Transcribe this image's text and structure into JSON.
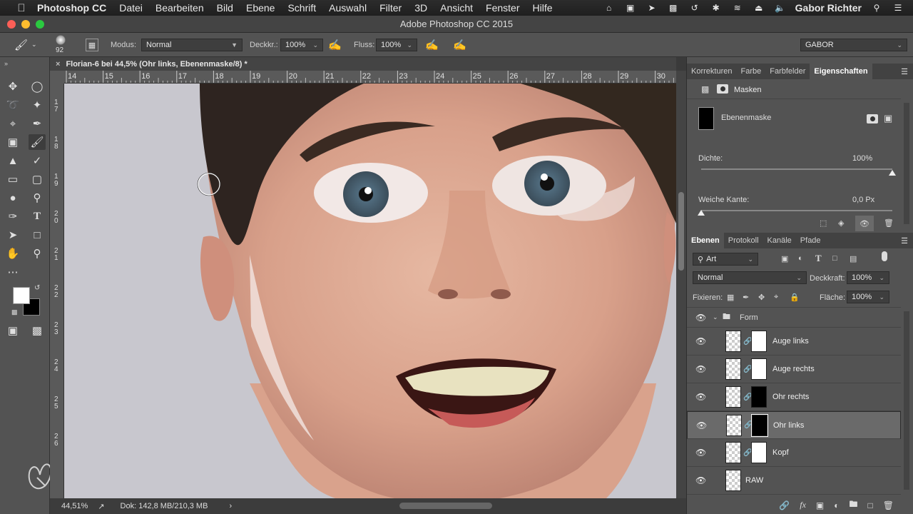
{
  "menubar": {
    "app": "Photoshop CC",
    "items": [
      "Datei",
      "Bearbeiten",
      "Bild",
      "Ebene",
      "Schrift",
      "Auswahl",
      "Filter",
      "3D",
      "Ansicht",
      "Fenster",
      "Hilfe"
    ],
    "user": "Gabor Richter"
  },
  "window": {
    "title": "Adobe Photoshop CC 2015"
  },
  "options": {
    "brush_size": "92",
    "modus_label": "Modus:",
    "modus_value": "Normal",
    "deckkraft_label": "Deckkr.:",
    "deckkraft_value": "100%",
    "fluss_label": "Fluss:",
    "fluss_value": "100%",
    "workspace": "GABOR"
  },
  "document": {
    "tab_title": "Florian-6 bei 44,5% (Ohr links, Ebenenmaske/8) *",
    "ruler_h": [
      "14",
      "15",
      "16",
      "17",
      "18",
      "19",
      "20",
      "21",
      "22",
      "23",
      "24",
      "25",
      "26",
      "27",
      "28",
      "29",
      "30"
    ],
    "ruler_v": [
      "1\n7",
      "1\n8",
      "1\n9",
      "2\n0",
      "2\n1",
      "2\n2",
      "2\n3",
      "2\n4",
      "2\n5",
      "2\n6"
    ]
  },
  "status": {
    "zoom": "44,51%",
    "doc": "Dok: 142,8 MB/210,3 MB"
  },
  "properties_panel": {
    "tabs": [
      "Korrekturen",
      "Farbe",
      "Farbfelder",
      "Eigenschaften"
    ],
    "active_tab": "Eigenschaften",
    "header": "Masken",
    "mask_label": "Ebenenmaske",
    "dichte_label": "Dichte:",
    "dichte_value": "100%",
    "dichte_fraction": 1.0,
    "weiche_label": "Weiche Kante:",
    "weiche_value": "0,0 Px",
    "weiche_fraction": 0.0
  },
  "layers_panel": {
    "tabs": [
      "Ebenen",
      "Protokoll",
      "Kanäle",
      "Pfade"
    ],
    "active_tab": "Ebenen",
    "filter_label": "Art",
    "blend_mode": "Normal",
    "deckkraft_label": "Deckkraft:",
    "deckkraft_value": "100%",
    "fixieren_label": "Fixieren:",
    "flaeche_label": "Fläche:",
    "flaeche_value": "100%",
    "group": "Form",
    "layers": [
      {
        "name": "Auge links",
        "mask": "white"
      },
      {
        "name": "Auge rechts",
        "mask": "white"
      },
      {
        "name": "Ohr rechts",
        "mask": "black"
      },
      {
        "name": "Ohr links",
        "mask": "black",
        "selected": true
      },
      {
        "name": "Kopf",
        "mask": "white"
      },
      {
        "name": "RAW",
        "mask": "none"
      }
    ]
  },
  "colors": {
    "foreground": "#ffffff",
    "background": "#000000",
    "accent": "#535353"
  }
}
